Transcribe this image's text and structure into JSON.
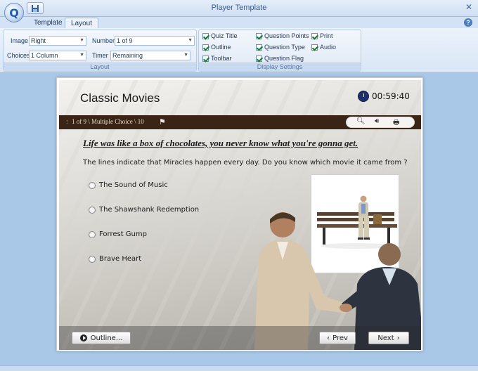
{
  "window": {
    "title": "Player Template"
  },
  "tabs": [
    {
      "label": "Template"
    },
    {
      "label": "Layout"
    }
  ],
  "layout_group": {
    "label": "Layout",
    "image": {
      "label": "Image",
      "value": "Right"
    },
    "choices": {
      "label": "Choices",
      "value": "1 Column"
    },
    "number": {
      "label": "Number",
      "value": "1 of 9"
    },
    "timer": {
      "label": "Timer",
      "value": "Remaining"
    }
  },
  "display_group": {
    "label": "Display Settings",
    "checks": [
      {
        "label": "Quiz Title",
        "checked": true
      },
      {
        "label": "Outline",
        "checked": true
      },
      {
        "label": "Toolbar",
        "checked": true
      },
      {
        "label": "Question Points",
        "checked": true
      },
      {
        "label": "Question Type",
        "checked": true
      },
      {
        "label": "Question Flag",
        "checked": true
      },
      {
        "label": "Print",
        "checked": true
      },
      {
        "label": "Audio",
        "checked": true
      }
    ]
  },
  "quiz": {
    "title": "Classic Movies",
    "timer": "00:59:40",
    "position_info": "1 of 9 \\ Multiple Choice \\ 10",
    "question": "Life was like a box of chocolates, you never know what you're gonna get.",
    "prompt": "The lines indicate that Miracles happen every day. Do you know which movie it came from ?",
    "choices": [
      {
        "label": "The Sound of Music"
      },
      {
        "label": "The Shawshank Redemption"
      },
      {
        "label": "Forrest Gump"
      },
      {
        "label": "Brave Heart"
      }
    ],
    "buttons": {
      "outline": "Outline...",
      "prev": "Prev",
      "next": "Next"
    }
  },
  "icons": {
    "app": "app-logo-icon",
    "save": "save-icon",
    "help": "help-icon",
    "close": "close-icon",
    "clock": "clock-icon",
    "flag": "flag-icon",
    "sound": "speaker-icon",
    "print": "printer-icon",
    "zoom": "magnifier-icon"
  }
}
